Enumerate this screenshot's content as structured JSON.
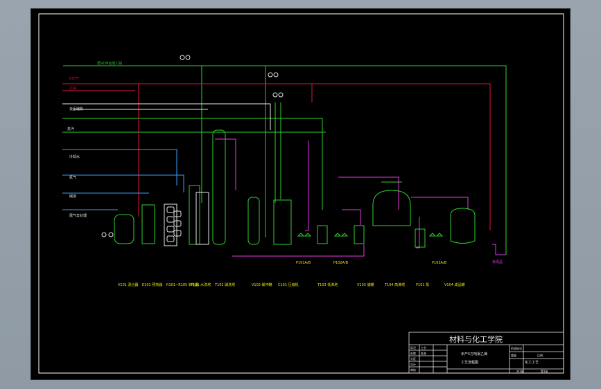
{
  "title_block": {
    "school": "材料与化工学院",
    "drawing_title_1": "年产5万吨氯乙烯",
    "drawing_title_2": "工艺流程图",
    "class_label": "化工工艺",
    "cells": [
      "标记",
      "处数",
      "分区",
      "设计",
      "审核",
      "工艺",
      "批准",
      "阶段标记",
      "重量",
      "比例",
      "共1张",
      "第1张"
    ]
  },
  "streams": {
    "top_green": "至VCM合成工段",
    "hcl_in": "HCl气",
    "c2h2_in": "乙炔",
    "recycle_gas": "去压缩机",
    "water_in": "冷却水",
    "n2": "氮气",
    "steam": "蒸汽",
    "alkali": "碱液",
    "purge": "尾气去处理",
    "product_out": "去成品"
  },
  "equipment_tags": [
    "V101 混合器",
    "E101 预热器",
    "R101~R105 转化器",
    "T101 水洗塔",
    "T102 碱洗塔",
    "V102 缓冲罐",
    "C101 压缩机",
    "T103 低沸塔",
    "V103 储罐",
    "T104 高沸塔",
    "P101 泵",
    "V104 成品罐"
  ],
  "pumps": [
    "P101A/B",
    "P102A/B",
    "P103A/B"
  ]
}
